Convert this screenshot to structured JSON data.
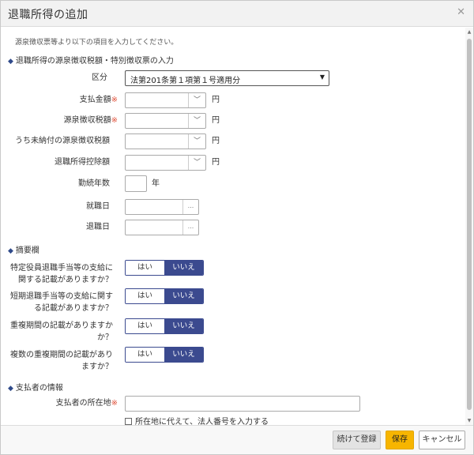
{
  "dialog": {
    "title": "退職所得の追加"
  },
  "intro": "源泉徴収票等より以下の項目を入力してください。",
  "section1": {
    "title": "退職所得の源泉徴収税額・特別徴収票の入力"
  },
  "fields": {
    "category_label": "区分",
    "category_value": "法第201条第１項第１号適用分",
    "payment_label": "支払金額",
    "withholding_label": "源泉徴収税額",
    "unpaid_withholding_label": "うち未納付の源泉徴収税額",
    "deduction_label": "退職所得控除額",
    "years_label": "勤続年数",
    "hire_date_label": "就職日",
    "retire_date_label": "退職日",
    "required_mark": "※",
    "yen_unit": "円",
    "year_unit": "年",
    "dropdown_glyph": "﹀",
    "date_glyph": "..."
  },
  "section2": {
    "title": "摘要欄"
  },
  "questions": {
    "q1": {
      "line1": "特定役員退職手当等の支給に",
      "line2": "関する記載がありますか？"
    },
    "q2": {
      "line1": "短期退職手当等の支給に関す",
      "line2": "る記載がありますか？"
    },
    "q3": {
      "line1": "重複期間の記載がありますか",
      "line2": "か？"
    },
    "q4": {
      "line1": "複数の重複期間の記載があり",
      "line2": "ますか？"
    },
    "yes": "はい",
    "no": "いいえ",
    "selected": "no"
  },
  "section3": {
    "title": "支払者の情報",
    "address_label": "支払者の所在地",
    "corp_checkbox_label": "所在地に代えて、法人番号を入力する",
    "corp_checkbox_checked": false
  },
  "footer": {
    "continue_label": "続けて登録",
    "save_label": "保存",
    "cancel_label": "キャンセル"
  },
  "colors": {
    "accent": "#3b4a8f",
    "required": "#e0533d",
    "save_button": "#f7b500"
  }
}
